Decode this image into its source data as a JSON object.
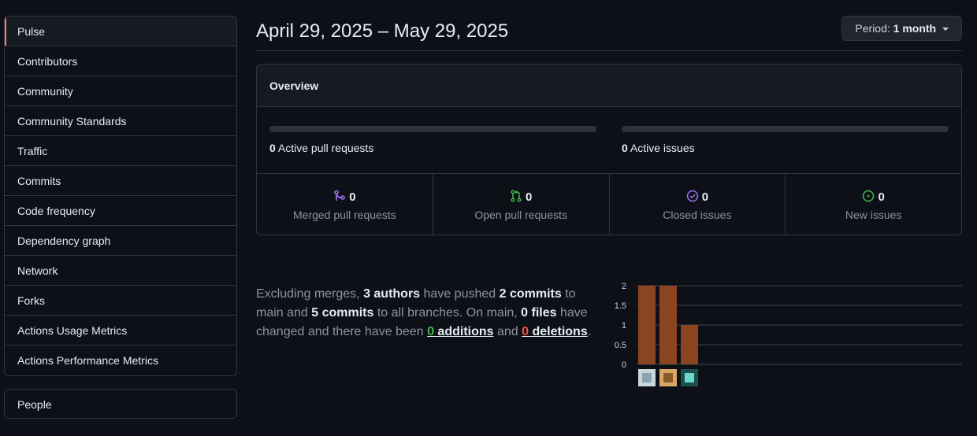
{
  "sidebar": {
    "items": [
      {
        "label": "Pulse",
        "active": true
      },
      {
        "label": "Contributors"
      },
      {
        "label": "Community"
      },
      {
        "label": "Community Standards"
      },
      {
        "label": "Traffic"
      },
      {
        "label": "Commits"
      },
      {
        "label": "Code frequency"
      },
      {
        "label": "Dependency graph"
      },
      {
        "label": "Network"
      },
      {
        "label": "Forks"
      },
      {
        "label": "Actions Usage Metrics"
      },
      {
        "label": "Actions Performance Metrics"
      }
    ],
    "people_label": "People"
  },
  "header": {
    "date_range": "April 29, 2025 – May 29, 2025",
    "period_prefix": "Period:",
    "period_value": "1 month"
  },
  "overview": {
    "title": "Overview",
    "active_prs_count": "0",
    "active_prs_label": "Active pull requests",
    "active_issues_count": "0",
    "active_issues_label": "Active issues",
    "active_prs_fraction": 0,
    "active_issues_fraction": 0,
    "stats": [
      {
        "count": "0",
        "label": "Merged pull requests",
        "icon": "merge-icon",
        "color": "#a371f7"
      },
      {
        "count": "0",
        "label": "Open pull requests",
        "icon": "pull-request-icon",
        "color": "#3fb950"
      },
      {
        "count": "0",
        "label": "Closed issues",
        "icon": "check-circle-icon",
        "color": "#a371f7"
      },
      {
        "count": "0",
        "label": "New issues",
        "icon": "issue-opened-icon",
        "color": "#3fb950"
      }
    ]
  },
  "summary": {
    "t1": "Excluding merges, ",
    "authors": "3 authors",
    "t2": " have pushed ",
    "commits_main": "2 commits",
    "t3": " to main and ",
    "commits_all": "5 commits",
    "t4": " to all branches. On main, ",
    "files": "0 files",
    "t5": " have changed and there have been ",
    "additions_n": "0",
    "additions_w": " additions",
    "t6": " and ",
    "deletions_n": "0",
    "deletions_w": " deletions",
    "t7": "."
  },
  "chart_data": {
    "type": "bar",
    "categories": [
      "author 1",
      "author 2",
      "author 3"
    ],
    "values": [
      2,
      2,
      1
    ],
    "yticks": [
      "0",
      "0.5",
      "1",
      "1.5",
      "2"
    ],
    "ylim": [
      0,
      2
    ],
    "bar_color": "#8a4520",
    "grid": true
  }
}
